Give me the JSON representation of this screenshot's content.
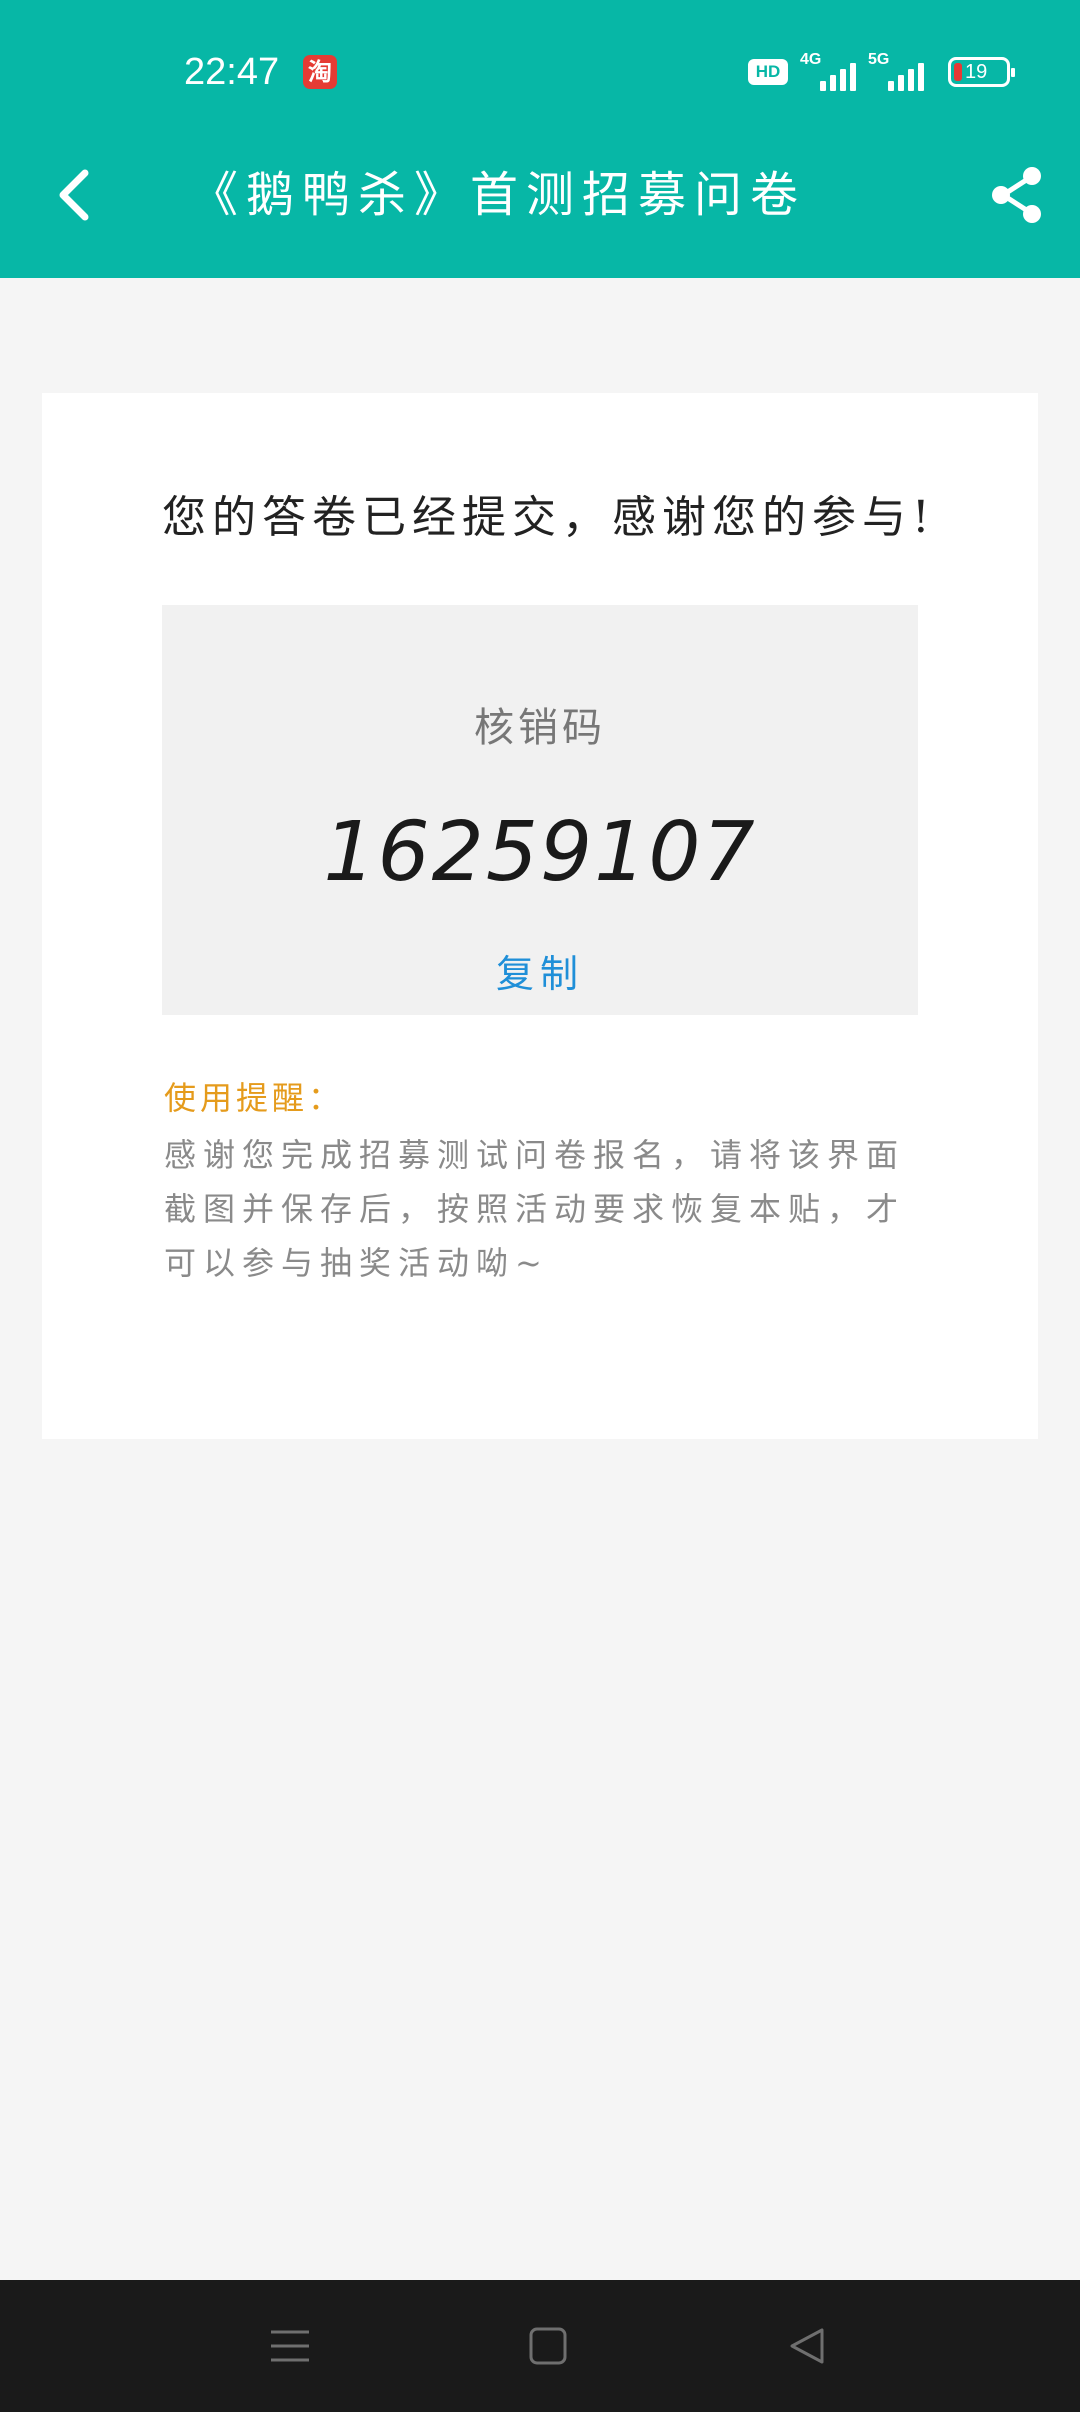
{
  "status_bar": {
    "time": "22:47",
    "taobao_glyph": "淘",
    "hd_label": "HD",
    "network_1": "4G",
    "network_2": "5G",
    "battery_level": "19",
    "icons": [
      "taobao-icon",
      "hd-icon",
      "signal-4g-icon",
      "signal-5g-icon",
      "battery-icon"
    ]
  },
  "header": {
    "title": "《鹅鸭杀》首测招募问卷",
    "back_icon": "chevron-left-icon",
    "share_icon": "share-icon",
    "background_color": "#07b7a6"
  },
  "result": {
    "confirmation_text": "您的答卷已经提交，感谢您的参与!",
    "code_label": "核销码",
    "code_value": "16259107",
    "copy_label": "复制",
    "copy_color": "#1f8fd8"
  },
  "tips": {
    "title": "使用提醒：",
    "body": "感谢您完成招募测试问卷报名，请将该界面截图并保存后，按照活动要求恢复本贴，才可以参与抽奖活动呦~",
    "title_color": "#e59b1c"
  },
  "nav_bar": {
    "icons": [
      "menu-icon",
      "home-icon",
      "back-triangle-icon"
    ]
  }
}
